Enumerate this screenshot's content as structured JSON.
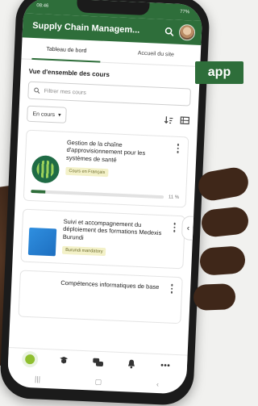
{
  "status_bar": {
    "time": "08:46",
    "battery": "77%"
  },
  "app_bar": {
    "title": "Supply Chain Managem..."
  },
  "tabs": [
    {
      "label": "Tableau de bord",
      "active": true
    },
    {
      "label": "Accueil du site",
      "active": false
    }
  ],
  "overview": {
    "title": "Vue d'ensemble des cours",
    "search_placeholder": "Filtrer mes cours",
    "filter_label": "En cours"
  },
  "courses": [
    {
      "title": "Gestion de la chaîne d'approvisionnement pour les systèmes de santé",
      "badge": "Cours en Français",
      "progress_percent": 11,
      "progress_label": "11 %"
    },
    {
      "title": "Suivi et accompagnement du déploiement des formations Medexis Burundi",
      "badge": "Burundi mandatory"
    },
    {
      "title": "Compétences informatiques de base"
    }
  ],
  "tag_label": "app",
  "colors": {
    "brand_green": "#2e6e3a",
    "progress_fill": "#2e6e3a",
    "badge_bg": "#f3f1c8"
  }
}
